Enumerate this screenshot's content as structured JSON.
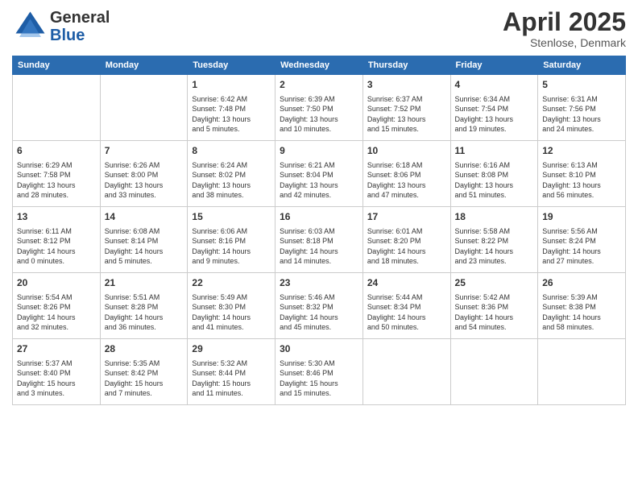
{
  "header": {
    "logo_general": "General",
    "logo_blue": "Blue",
    "month_title": "April 2025",
    "location": "Stenlose, Denmark"
  },
  "calendar": {
    "days_of_week": [
      "Sunday",
      "Monday",
      "Tuesday",
      "Wednesday",
      "Thursday",
      "Friday",
      "Saturday"
    ],
    "weeks": [
      [
        {
          "day": "",
          "info": ""
        },
        {
          "day": "",
          "info": ""
        },
        {
          "day": "1",
          "info": "Sunrise: 6:42 AM\nSunset: 7:48 PM\nDaylight: 13 hours\nand 5 minutes."
        },
        {
          "day": "2",
          "info": "Sunrise: 6:39 AM\nSunset: 7:50 PM\nDaylight: 13 hours\nand 10 minutes."
        },
        {
          "day": "3",
          "info": "Sunrise: 6:37 AM\nSunset: 7:52 PM\nDaylight: 13 hours\nand 15 minutes."
        },
        {
          "day": "4",
          "info": "Sunrise: 6:34 AM\nSunset: 7:54 PM\nDaylight: 13 hours\nand 19 minutes."
        },
        {
          "day": "5",
          "info": "Sunrise: 6:31 AM\nSunset: 7:56 PM\nDaylight: 13 hours\nand 24 minutes."
        }
      ],
      [
        {
          "day": "6",
          "info": "Sunrise: 6:29 AM\nSunset: 7:58 PM\nDaylight: 13 hours\nand 28 minutes."
        },
        {
          "day": "7",
          "info": "Sunrise: 6:26 AM\nSunset: 8:00 PM\nDaylight: 13 hours\nand 33 minutes."
        },
        {
          "day": "8",
          "info": "Sunrise: 6:24 AM\nSunset: 8:02 PM\nDaylight: 13 hours\nand 38 minutes."
        },
        {
          "day": "9",
          "info": "Sunrise: 6:21 AM\nSunset: 8:04 PM\nDaylight: 13 hours\nand 42 minutes."
        },
        {
          "day": "10",
          "info": "Sunrise: 6:18 AM\nSunset: 8:06 PM\nDaylight: 13 hours\nand 47 minutes."
        },
        {
          "day": "11",
          "info": "Sunrise: 6:16 AM\nSunset: 8:08 PM\nDaylight: 13 hours\nand 51 minutes."
        },
        {
          "day": "12",
          "info": "Sunrise: 6:13 AM\nSunset: 8:10 PM\nDaylight: 13 hours\nand 56 minutes."
        }
      ],
      [
        {
          "day": "13",
          "info": "Sunrise: 6:11 AM\nSunset: 8:12 PM\nDaylight: 14 hours\nand 0 minutes."
        },
        {
          "day": "14",
          "info": "Sunrise: 6:08 AM\nSunset: 8:14 PM\nDaylight: 14 hours\nand 5 minutes."
        },
        {
          "day": "15",
          "info": "Sunrise: 6:06 AM\nSunset: 8:16 PM\nDaylight: 14 hours\nand 9 minutes."
        },
        {
          "day": "16",
          "info": "Sunrise: 6:03 AM\nSunset: 8:18 PM\nDaylight: 14 hours\nand 14 minutes."
        },
        {
          "day": "17",
          "info": "Sunrise: 6:01 AM\nSunset: 8:20 PM\nDaylight: 14 hours\nand 18 minutes."
        },
        {
          "day": "18",
          "info": "Sunrise: 5:58 AM\nSunset: 8:22 PM\nDaylight: 14 hours\nand 23 minutes."
        },
        {
          "day": "19",
          "info": "Sunrise: 5:56 AM\nSunset: 8:24 PM\nDaylight: 14 hours\nand 27 minutes."
        }
      ],
      [
        {
          "day": "20",
          "info": "Sunrise: 5:54 AM\nSunset: 8:26 PM\nDaylight: 14 hours\nand 32 minutes."
        },
        {
          "day": "21",
          "info": "Sunrise: 5:51 AM\nSunset: 8:28 PM\nDaylight: 14 hours\nand 36 minutes."
        },
        {
          "day": "22",
          "info": "Sunrise: 5:49 AM\nSunset: 8:30 PM\nDaylight: 14 hours\nand 41 minutes."
        },
        {
          "day": "23",
          "info": "Sunrise: 5:46 AM\nSunset: 8:32 PM\nDaylight: 14 hours\nand 45 minutes."
        },
        {
          "day": "24",
          "info": "Sunrise: 5:44 AM\nSunset: 8:34 PM\nDaylight: 14 hours\nand 50 minutes."
        },
        {
          "day": "25",
          "info": "Sunrise: 5:42 AM\nSunset: 8:36 PM\nDaylight: 14 hours\nand 54 minutes."
        },
        {
          "day": "26",
          "info": "Sunrise: 5:39 AM\nSunset: 8:38 PM\nDaylight: 14 hours\nand 58 minutes."
        }
      ],
      [
        {
          "day": "27",
          "info": "Sunrise: 5:37 AM\nSunset: 8:40 PM\nDaylight: 15 hours\nand 3 minutes."
        },
        {
          "day": "28",
          "info": "Sunrise: 5:35 AM\nSunset: 8:42 PM\nDaylight: 15 hours\nand 7 minutes."
        },
        {
          "day": "29",
          "info": "Sunrise: 5:32 AM\nSunset: 8:44 PM\nDaylight: 15 hours\nand 11 minutes."
        },
        {
          "day": "30",
          "info": "Sunrise: 5:30 AM\nSunset: 8:46 PM\nDaylight: 15 hours\nand 15 minutes."
        },
        {
          "day": "",
          "info": ""
        },
        {
          "day": "",
          "info": ""
        },
        {
          "day": "",
          "info": ""
        }
      ]
    ]
  }
}
